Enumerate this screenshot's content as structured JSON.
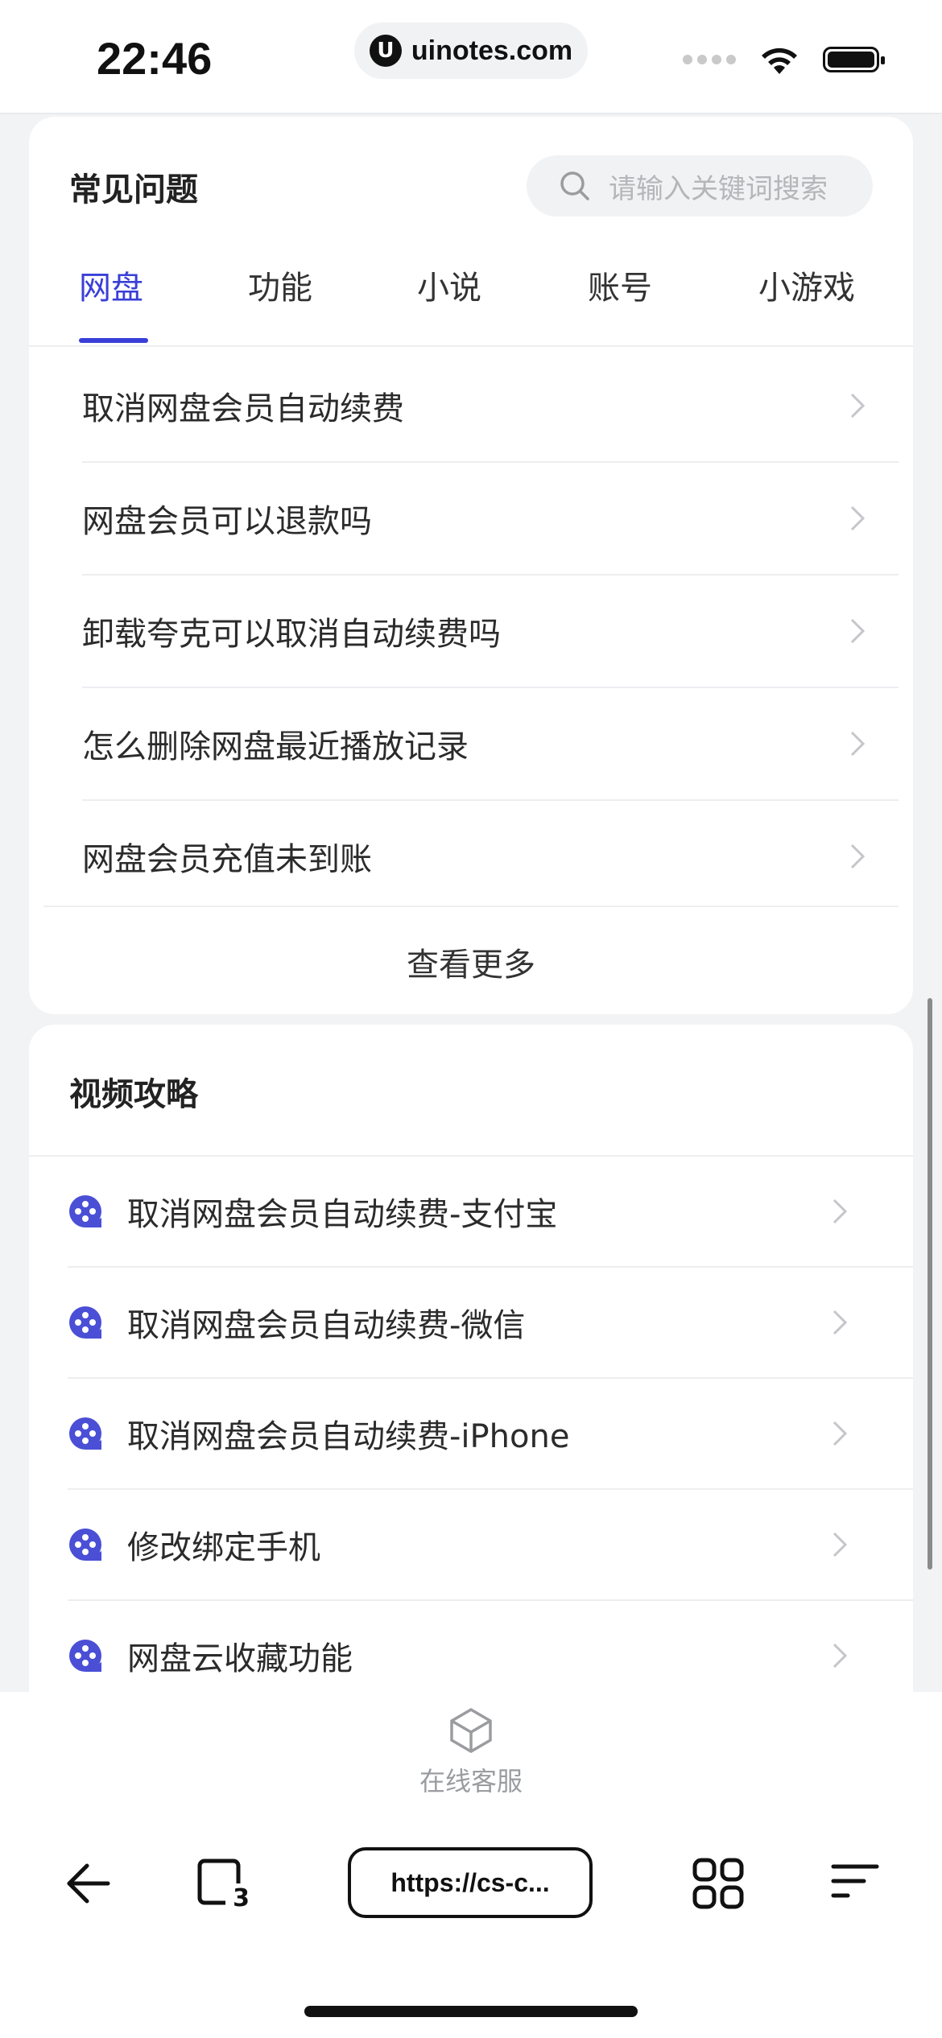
{
  "status_bar": {
    "time": "22:46",
    "site": "uinotes.com",
    "site_logo_letter": "U"
  },
  "faq": {
    "title": "常见问题",
    "search_placeholder": "请输入关键词搜索",
    "tabs": [
      {
        "label": "网盘",
        "active": true
      },
      {
        "label": "功能",
        "active": false
      },
      {
        "label": "小说",
        "active": false
      },
      {
        "label": "账号",
        "active": false
      },
      {
        "label": "小游戏",
        "active": false
      }
    ],
    "items": [
      {
        "label": "取消网盘会员自动续费"
      },
      {
        "label": "网盘会员可以退款吗"
      },
      {
        "label": "卸载夸克可以取消自动续费吗"
      },
      {
        "label": "怎么删除网盘最近播放记录"
      },
      {
        "label": "网盘会员充值未到账"
      }
    ],
    "more_label": "查看更多"
  },
  "video": {
    "title": "视频攻略",
    "items": [
      {
        "label": "取消网盘会员自动续费-支付宝"
      },
      {
        "label": "取消网盘会员自动续费-微信"
      },
      {
        "label": "取消网盘会员自动续费-iPhone"
      },
      {
        "label": "修改绑定手机"
      },
      {
        "label": "网盘云收藏功能"
      }
    ]
  },
  "service": {
    "label": "在线客服",
    "icon": "customer-service-icon"
  },
  "browser_toolbar": {
    "url": "https://cs-c...",
    "tab_count": "3",
    "icons": [
      "back-icon",
      "tabs-icon",
      "apps-grid-icon",
      "menu-icon"
    ]
  },
  "colors": {
    "accent": "#3a3fd8",
    "video_icon": "#4a4fd6",
    "background": "#f2f3f5"
  }
}
